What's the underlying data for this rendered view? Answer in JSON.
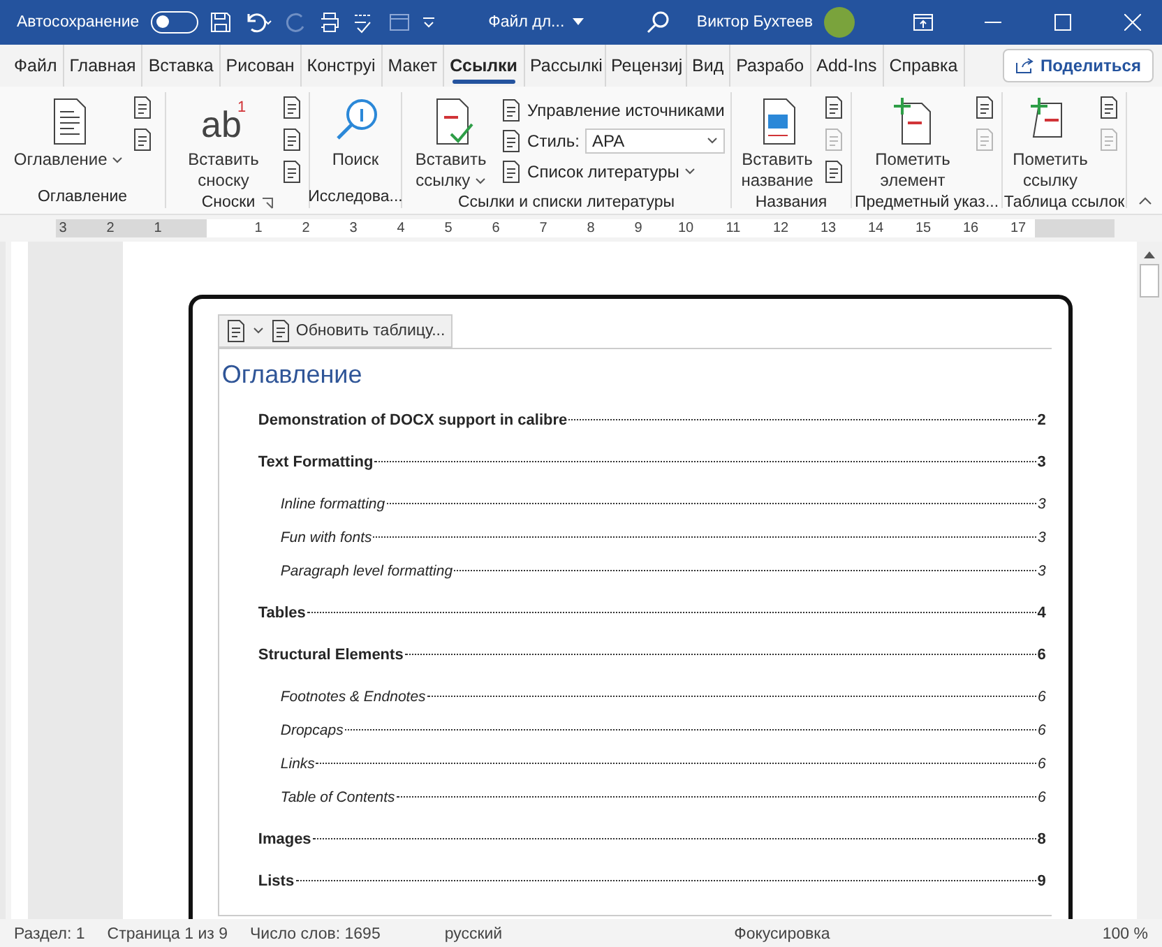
{
  "title_bar": {
    "autosave_label": "Автосохранение",
    "autosave": {
      "on": false
    },
    "file_name": "Файл дл...",
    "user_name": "Виктор Бухтеев"
  },
  "tabs": [
    {
      "label": "Файл",
      "selected": false
    },
    {
      "label": "Главная",
      "selected": false
    },
    {
      "label": "Вставка",
      "selected": false
    },
    {
      "label": "Рисован",
      "selected": false
    },
    {
      "label": "Конструі",
      "selected": false
    },
    {
      "label": "Макет",
      "selected": false
    },
    {
      "label": "Ссылки",
      "selected": true
    },
    {
      "label": "Рассылкі",
      "selected": false
    },
    {
      "label": "Рецензиј",
      "selected": false
    },
    {
      "label": "Вид",
      "selected": false
    },
    {
      "label": "Разрабо",
      "selected": false
    },
    {
      "label": "Add-Ins",
      "selected": false
    },
    {
      "label": "Справка",
      "selected": false
    }
  ],
  "share_button": "Поделиться",
  "ribbon": [
    {
      "label": "Оглавление",
      "large": {
        "label": "Оглавление",
        "caret": true
      },
      "small": [
        {
          "disabled": false
        },
        {
          "disabled": false
        }
      ]
    },
    {
      "label": "Сноски",
      "large": {
        "label": "Вставить сноску",
        "caret": false,
        "icon_text": "ab",
        "icon_mark": "1"
      },
      "small": [
        {
          "disabled": false
        },
        {
          "disabled": false
        },
        {
          "disabled": false
        }
      ],
      "launcher": true
    },
    {
      "label": "Исследова...",
      "large": {
        "label": "Поиск",
        "caret": false
      }
    },
    {
      "label": "Ссылки и списки литературы",
      "large": {
        "label": "Вставить ссылку",
        "caret": true
      },
      "manage_sources": "Управление источниками",
      "style_label": "Стиль:",
      "style_value": "APA",
      "bibliography": "Список литературы"
    },
    {
      "label": "Названия",
      "large": {
        "label": "Вставить название",
        "caret": false
      },
      "small": [
        {
          "disabled": false
        },
        {
          "disabled": true
        },
        {
          "disabled": false
        }
      ]
    },
    {
      "label": "Предметный указ...",
      "large": {
        "label": "Пометить элемент",
        "caret": false
      },
      "small": [
        {
          "disabled": false
        },
        {
          "disabled": true
        }
      ]
    },
    {
      "label": "Таблица ссылок",
      "large": {
        "label": "Пометить ссылку",
        "caret": false
      },
      "small": [
        {
          "disabled": false
        },
        {
          "disabled": true
        }
      ]
    }
  ],
  "ruler": {
    "labels": [
      "3",
      "2",
      "1",
      "1",
      "2",
      "3",
      "4",
      "5",
      "6",
      "7",
      "8",
      "9",
      "10",
      "11",
      "12",
      "13",
      "14",
      "15",
      "16",
      "17"
    ]
  },
  "document": {
    "update_button": "Обновить таблицу...",
    "toc_title": "Оглавление",
    "entries": [
      {
        "text": "Demonstration of DOCX support in calibre",
        "page": "2"
      },
      {
        "text": "Text Formatting",
        "page": "3",
        "children": [
          {
            "text": "Inline formatting",
            "page": "3"
          },
          {
            "text": "Fun with fonts",
            "page": "3"
          },
          {
            "text": "Paragraph level formatting",
            "page": "3"
          }
        ]
      },
      {
        "text": "Tables",
        "page": "4"
      },
      {
        "text": "Structural Elements",
        "page": "6",
        "children": [
          {
            "text": "Footnotes & Endnotes",
            "page": "6"
          },
          {
            "text": "Dropcaps",
            "page": "6"
          },
          {
            "text": "Links",
            "page": "6"
          },
          {
            "text": "Table of Contents",
            "page": "6"
          }
        ]
      },
      {
        "text": "Images",
        "page": "8"
      },
      {
        "text": "Lists",
        "page": "9"
      }
    ]
  },
  "status_bar": {
    "section": "Раздел: 1",
    "page": "Страница 1 из 9",
    "words": "Число слов: 1695",
    "language": "русский",
    "focus": "Фокусировка",
    "zoom": "100 %"
  }
}
